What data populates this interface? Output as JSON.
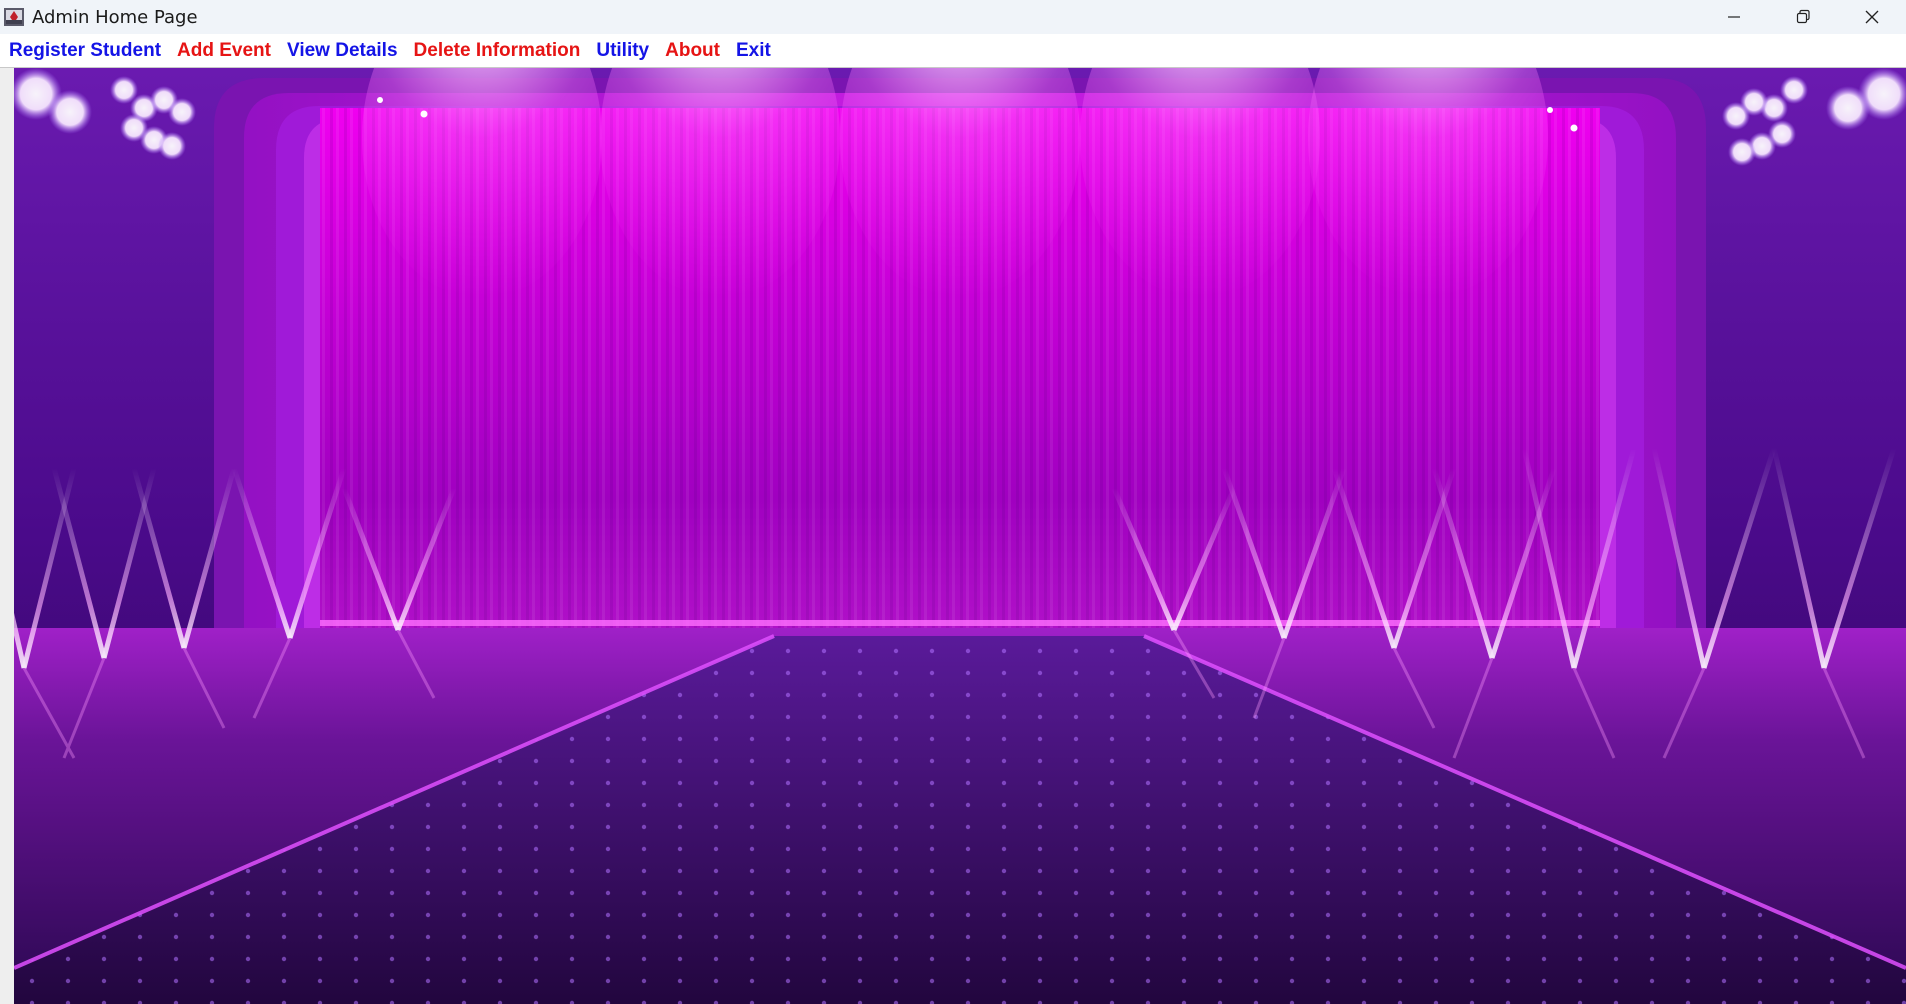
{
  "window": {
    "title": "Admin Home Page",
    "icon": "java-app-icon",
    "controls": {
      "minimize": "minimize-icon",
      "restore": "restore-icon",
      "close": "close-icon"
    }
  },
  "menu": {
    "items": [
      {
        "label": "Register Student",
        "color": "#1414e6"
      },
      {
        "label": "Add Event",
        "color": "#e61414"
      },
      {
        "label": "View Details",
        "color": "#1414e6"
      },
      {
        "label": "Delete Information",
        "color": "#e61414"
      },
      {
        "label": "Utility",
        "color": "#1414e6"
      },
      {
        "label": "About",
        "color": "#e61414"
      },
      {
        "label": "Exit",
        "color": "#1414e6"
      }
    ]
  },
  "background_image": {
    "subject": "purple stage with curtains and spotlights",
    "accent": "#e100e6",
    "dark": "#2a0a4a"
  }
}
